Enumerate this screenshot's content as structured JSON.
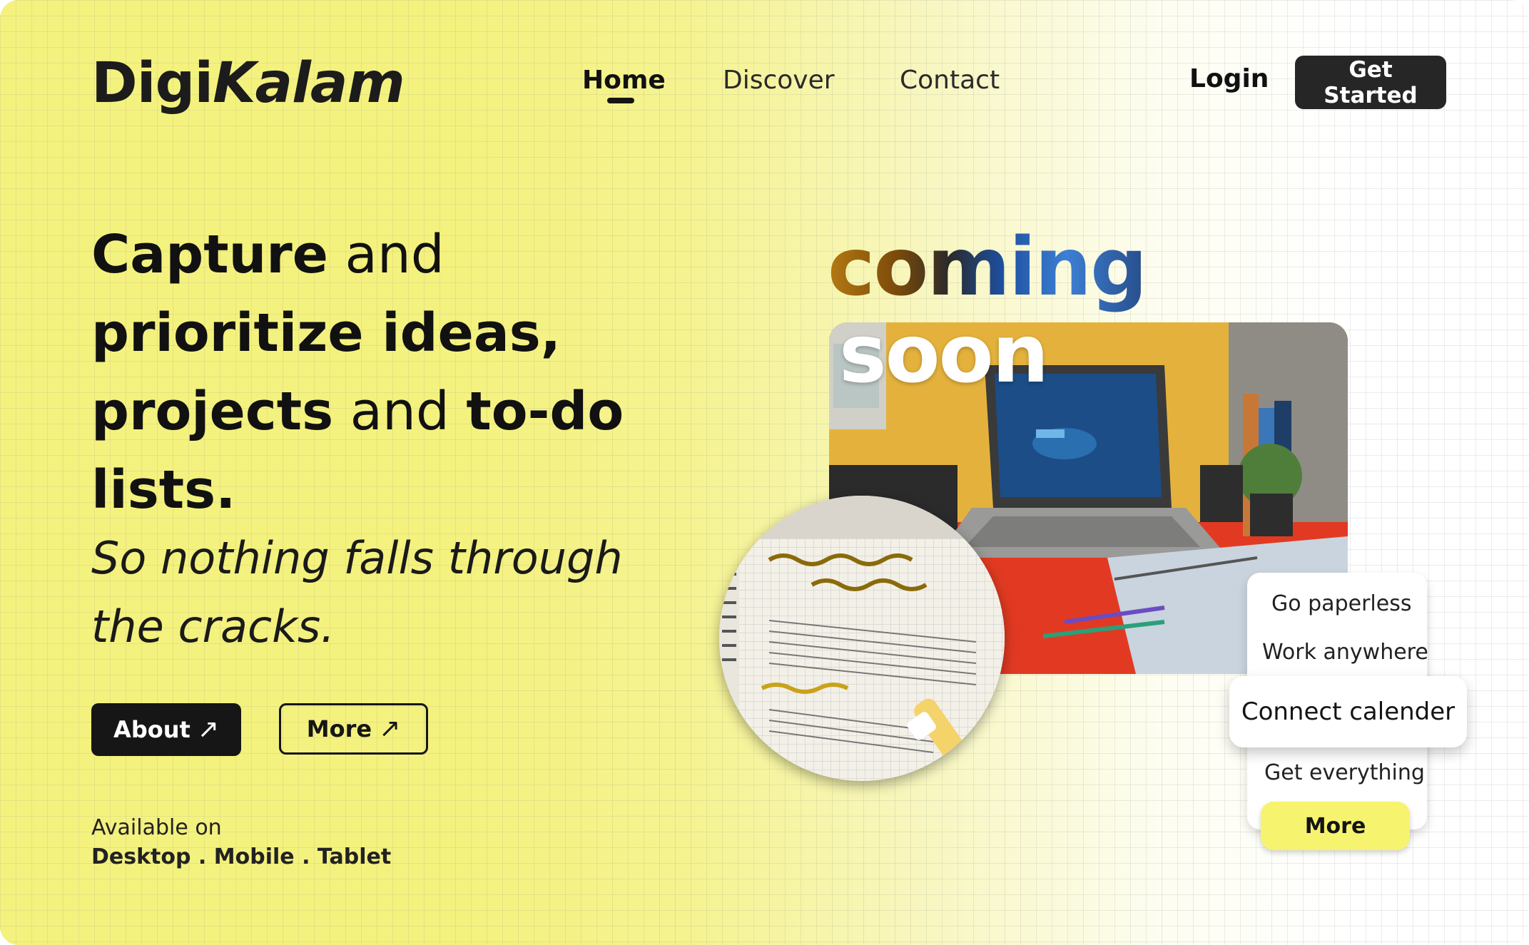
{
  "brand": {
    "logo_regular": "Digi",
    "logo_italic": "Kalam"
  },
  "nav": {
    "home": "Home",
    "discover": "Discover",
    "contact": "Contact",
    "active": "Home"
  },
  "header": {
    "login": "Login",
    "cta": "Get Started"
  },
  "hero": {
    "line1_bold": "Capture",
    "line1_rest": " and",
    "line2_bold": "prioritize ideas,",
    "line3_bold": "projects",
    "line3_rest": " and ",
    "line3_bold2": "to-do",
    "line4_bold": "lists.",
    "tagline": "So nothing falls through the cracks.",
    "about_button": "About",
    "more_button": "More",
    "arrow_icon": "↗",
    "available_label": "Available on",
    "platforms": "Desktop . Mobile . Tablet"
  },
  "visual": {
    "coming": "coming",
    "soon": "soon",
    "photo_icon": "desk-photo",
    "notebook_icon": "notebook-photo"
  },
  "feature_card": {
    "items": [
      "Go paperless",
      "Work anywhere",
      "Connect calender",
      "Get everything"
    ],
    "more": "More"
  },
  "colors": {
    "accent_yellow": "#f4f27e",
    "dark": "#262626",
    "card_button": "#f6f36f"
  }
}
